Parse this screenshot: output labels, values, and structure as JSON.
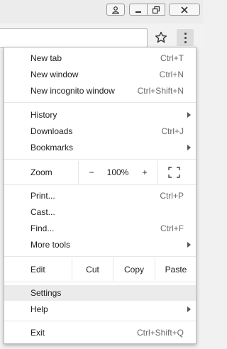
{
  "menu": {
    "items": {
      "new_tab": {
        "label": "New tab",
        "shortcut": "Ctrl+T"
      },
      "new_window": {
        "label": "New window",
        "shortcut": "Ctrl+N"
      },
      "new_incognito": {
        "label": "New incognito window",
        "shortcut": "Ctrl+Shift+N"
      },
      "history": {
        "label": "History"
      },
      "downloads": {
        "label": "Downloads",
        "shortcut": "Ctrl+J"
      },
      "bookmarks": {
        "label": "Bookmarks"
      },
      "print": {
        "label": "Print...",
        "shortcut": "Ctrl+P"
      },
      "cast": {
        "label": "Cast..."
      },
      "find": {
        "label": "Find...",
        "shortcut": "Ctrl+F"
      },
      "more_tools": {
        "label": "More tools"
      },
      "settings": {
        "label": "Settings"
      },
      "help": {
        "label": "Help"
      },
      "exit": {
        "label": "Exit",
        "shortcut": "Ctrl+Shift+Q"
      }
    },
    "zoom": {
      "label": "Zoom",
      "minus": "−",
      "value": "100%",
      "plus": "+"
    },
    "edit": {
      "label": "Edit",
      "cut": "Cut",
      "copy": "Copy",
      "paste": "Paste"
    }
  },
  "icons": {
    "profile": "profile-icon",
    "minimize": "minimize-icon",
    "restore": "restore-icon",
    "close": "close-icon",
    "bookmark_star": "star-icon",
    "menu": "kebab-menu-icon",
    "fullscreen": "fullscreen-icon"
  },
  "colors": {
    "hover_row": "#ebebeb",
    "menu_bg": "#ffffff",
    "chrome_bg": "#f1f1f1"
  }
}
